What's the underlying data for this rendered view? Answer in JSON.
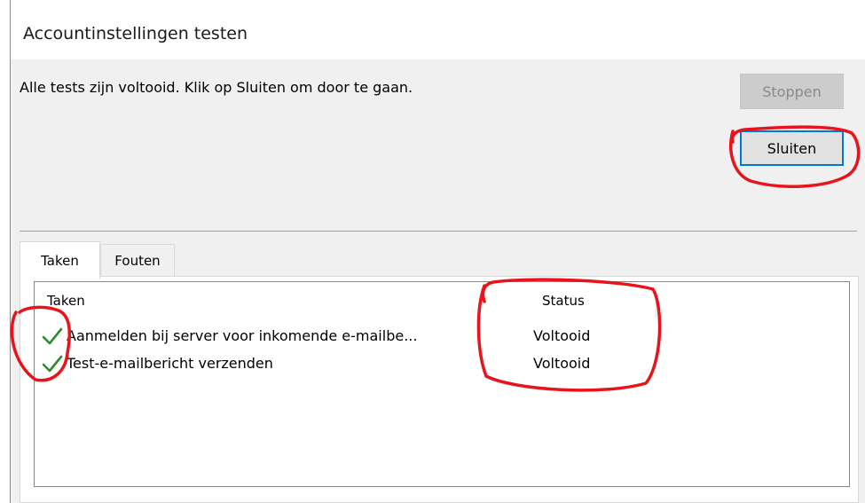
{
  "window": {
    "title": "Accountinstellingen testen"
  },
  "dialog": {
    "message": "Alle tests zijn voltooid. Klik op Sluiten om door te gaan.",
    "buttons": {
      "stop": "Stoppen",
      "close": "Sluiten"
    }
  },
  "tabs": [
    {
      "label": "Taken",
      "active": true
    },
    {
      "label": "Fouten",
      "active": false
    }
  ],
  "list": {
    "columns": {
      "task": "Taken",
      "status": "Status"
    },
    "rows": [
      {
        "task": "Aanmelden bij server voor inkomende e-mailbe...",
        "status": "Voltooid",
        "icon": "checkmark-icon"
      },
      {
        "task": "Test-e-mailbericht verzenden",
        "status": "Voltooid",
        "icon": "checkmark-icon"
      }
    ]
  },
  "colors": {
    "check": "#2e8b2e",
    "annotation": "#e8141b",
    "focus_border": "#0078d7",
    "dialog_bg": "#f0f0f0"
  }
}
